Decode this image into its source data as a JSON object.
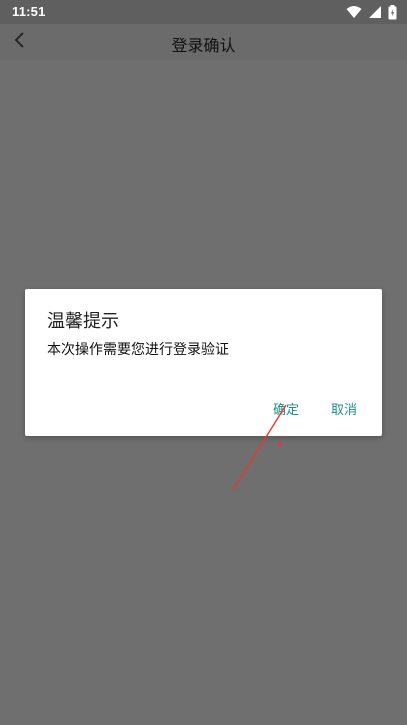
{
  "status_bar": {
    "time": "11:51",
    "icons": [
      "wifi-icon",
      "cell-signal-icon",
      "battery-icon"
    ]
  },
  "header": {
    "back_icon": "chevron-left-icon",
    "title": "登录确认"
  },
  "dialog": {
    "title": "温馨提示",
    "message": "本次操作需要您进行登录验证",
    "confirm_label": "确定",
    "cancel_label": "取消"
  },
  "colors": {
    "overlay": "#6f6f6f",
    "status_bar": "#5f5f5f",
    "dialog_bg": "#ffffff",
    "button_text": "#1f8f88",
    "annotation": "#e53935"
  }
}
